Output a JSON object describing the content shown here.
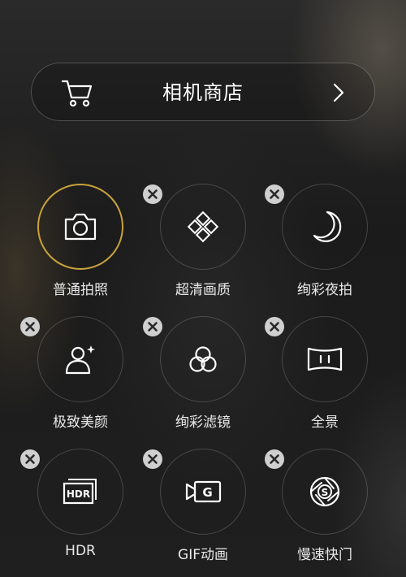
{
  "store": {
    "title": "相机商店",
    "cart_icon": "cart-icon",
    "arrow_icon": "chevron-right-icon"
  },
  "colors": {
    "active_ring": "#c8a23c",
    "remove_badge": "#cfcfcf"
  },
  "modes": [
    {
      "label": "普通拍照",
      "icon": "camera-icon",
      "active": true,
      "removable": false
    },
    {
      "label": "超清画质",
      "icon": "diamond-grid-icon",
      "active": false,
      "removable": true
    },
    {
      "label": "绚彩夜拍",
      "icon": "crescent-moon-icon",
      "active": false,
      "removable": true
    },
    {
      "label": "极致美颜",
      "icon": "beauty-person-icon",
      "active": false,
      "removable": true
    },
    {
      "label": "绚彩滤镜",
      "icon": "filter-circles-icon",
      "active": false,
      "removable": true
    },
    {
      "label": "全景",
      "icon": "panorama-icon",
      "active": false,
      "removable": true
    },
    {
      "label": "HDR",
      "icon": "hdr-icon",
      "active": false,
      "removable": true
    },
    {
      "label": "GIF动画",
      "icon": "gif-icon",
      "active": false,
      "removable": true
    },
    {
      "label": "慢速快门",
      "icon": "slow-shutter-icon",
      "active": false,
      "removable": true
    }
  ]
}
